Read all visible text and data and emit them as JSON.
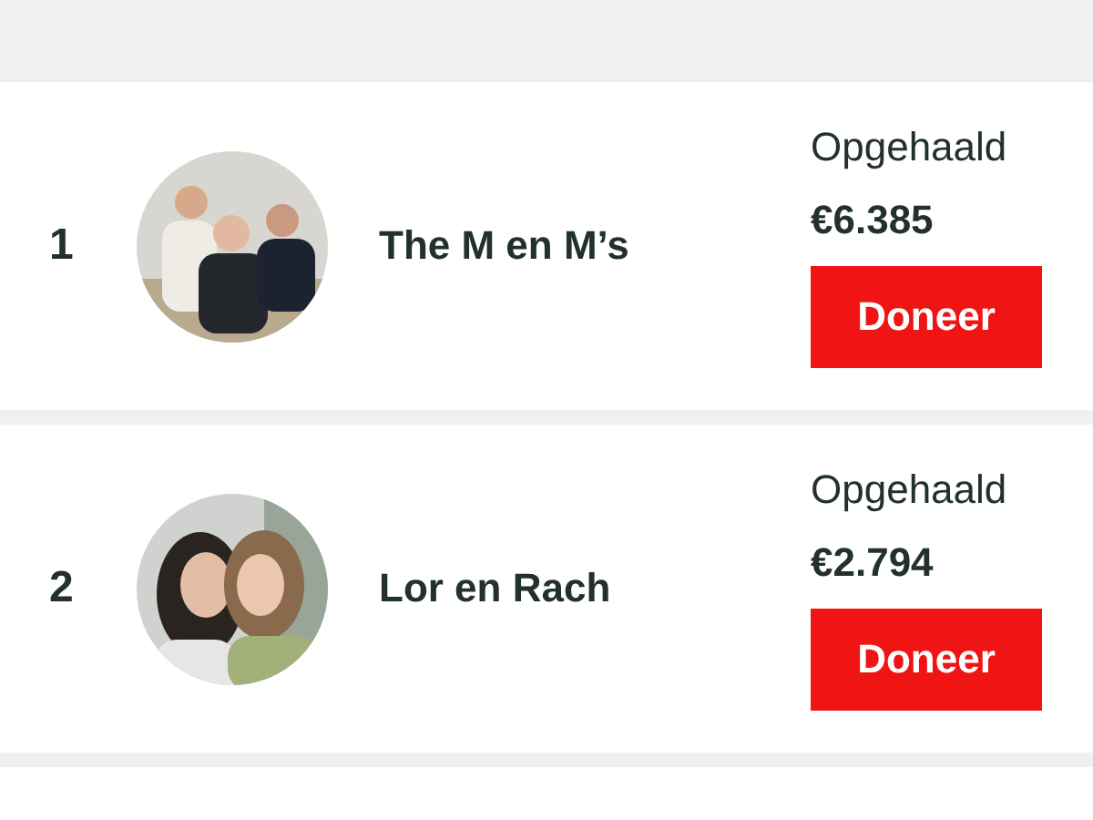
{
  "entries": [
    {
      "rank": "1",
      "name": "The M en M’s",
      "label": "Opgehaald",
      "amount": "€6.385",
      "button": "Doneer"
    },
    {
      "rank": "2",
      "name": "Lor en Rach",
      "label": "Opgehaald",
      "amount": "€2.794",
      "button": "Doneer"
    }
  ]
}
